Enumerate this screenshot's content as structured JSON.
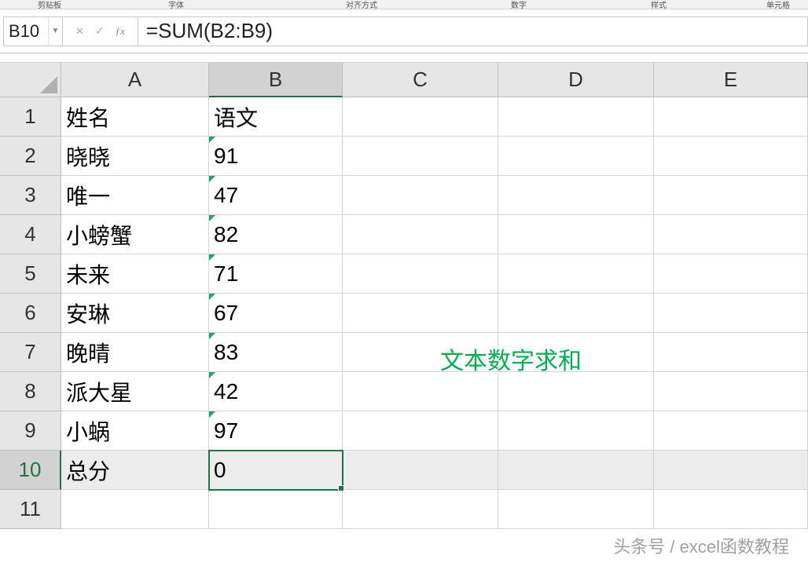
{
  "ribbon_groups": {
    "g1": "剪贴板",
    "g2": "字体",
    "g3": "对齐方式",
    "g4": "数字",
    "g5": "样式",
    "g6": "单元格"
  },
  "name_box": "B10",
  "formula": "=SUM(B2:B9)",
  "columns": [
    "A",
    "B",
    "C",
    "D",
    "E"
  ],
  "selected_column_index": 1,
  "selected_row_index": 9,
  "rows": [
    {
      "num": "1",
      "A": "姓名",
      "B": "语文",
      "textB": false
    },
    {
      "num": "2",
      "A": "晓晓",
      "B": "91",
      "textB": true
    },
    {
      "num": "3",
      "A": "唯一",
      "B": "47",
      "textB": true
    },
    {
      "num": "4",
      "A": "小螃蟹",
      "B": "82",
      "textB": true
    },
    {
      "num": "5",
      "A": "未来",
      "B": "71",
      "textB": true
    },
    {
      "num": "6",
      "A": "安琳",
      "B": "67",
      "textB": true
    },
    {
      "num": "7",
      "A": "晚晴",
      "B": "83",
      "textB": true
    },
    {
      "num": "8",
      "A": "派大星",
      "B": "42",
      "textB": true
    },
    {
      "num": "9",
      "A": "小蜗",
      "B": "97",
      "textB": true
    },
    {
      "num": "10",
      "A": "总分",
      "B": "0",
      "textB": false,
      "active": true
    },
    {
      "num": "11",
      "A": "",
      "B": "",
      "textB": false
    }
  ],
  "annotation": "文本数字求和",
  "watermark": "头条号 / excel函数教程"
}
